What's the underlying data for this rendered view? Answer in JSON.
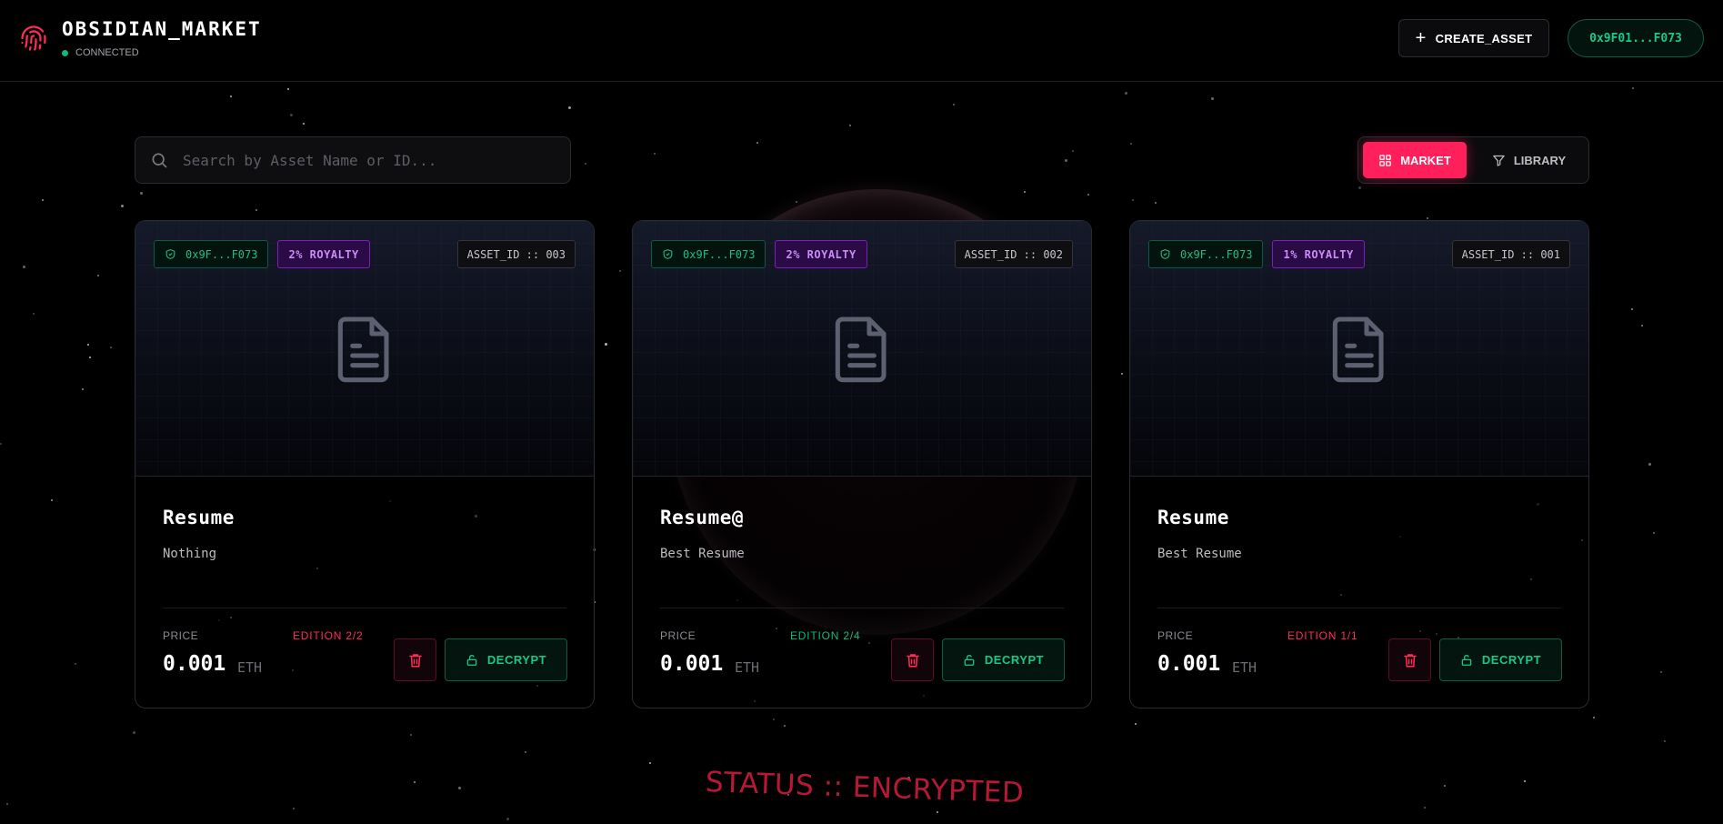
{
  "header": {
    "title": "OBSIDIAN_MARKET",
    "status": "CONNECTED",
    "create_label": "CREATE_ASSET",
    "wallet": "0x9F01...F073"
  },
  "search": {
    "placeholder": "Search by Asset Name or ID..."
  },
  "view_toggle": {
    "market": "MARKET",
    "library": "LIBRARY",
    "active": "MARKET"
  },
  "cards": [
    {
      "owner": "0x9F...F073",
      "royalty": "2% ROYALTY",
      "asset_id": "ASSET_ID :: 003",
      "name": "Resume",
      "description": "Nothing",
      "price_label": "PRICE",
      "edition": "EDITION 2/2",
      "price": "0.001",
      "unit": "ETH",
      "action": "DECRYPT"
    },
    {
      "owner": "0x9F...F073",
      "royalty": "2% ROYALTY",
      "asset_id": "ASSET_ID :: 002",
      "name": "Resume@",
      "description": "Best Resume",
      "price_label": "PRICE",
      "edition": "EDITION 2/4",
      "price": "0.001",
      "unit": "ETH",
      "action": "DECRYPT"
    },
    {
      "owner": "0x9F...F073",
      "royalty": "1% ROYALTY",
      "asset_id": "ASSET_ID :: 001",
      "name": "Resume",
      "description": "Best Resume",
      "price_label": "PRICE",
      "edition": "EDITION 1/1",
      "price": "0.001",
      "unit": "ETH",
      "action": "DECRYPT"
    }
  ],
  "edition_colors": [
    "#ff2d55",
    "#10b981",
    "#ff2d55"
  ],
  "colors": {
    "accent": "#ff1f5a",
    "success": "#10b981",
    "royalty": "#a855f7",
    "status": "#b81836"
  },
  "icons": {
    "logo": "fingerprint-icon",
    "search": "search-icon",
    "market": "grid-icon",
    "library": "filter-icon",
    "owner": "shield-check-icon",
    "asset": "document-icon",
    "delete": "trash-icon",
    "decrypt": "unlock-icon"
  },
  "footer": {
    "status": "STATUS :: ENCRYPTED"
  }
}
